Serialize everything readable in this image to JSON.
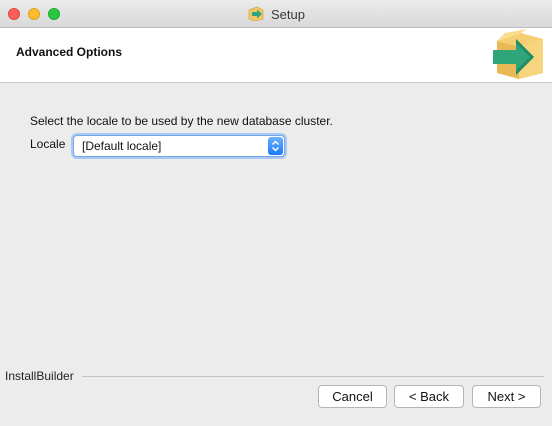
{
  "window": {
    "title": "Setup"
  },
  "header": {
    "title": "Advanced Options"
  },
  "main": {
    "description": "Select the locale to be used by the new database cluster.",
    "locale_label": "Locale",
    "locale_value": "[Default locale]"
  },
  "footer": {
    "brand": "InstallBuilder",
    "cancel_label": "Cancel",
    "back_label": "< Back",
    "next_label": "Next >"
  },
  "icons": {
    "title_icon": "package-arrow-icon",
    "header_icon": "package-arrow-icon",
    "select_arrows": "updown-chevron-icon"
  },
  "colors": {
    "accent": "#1a7cf5",
    "close": "#fc5f57",
    "minimize": "#fdbc2e",
    "maximize": "#28c840",
    "box": "#f3c766",
    "arrow": "#2fa57c"
  }
}
